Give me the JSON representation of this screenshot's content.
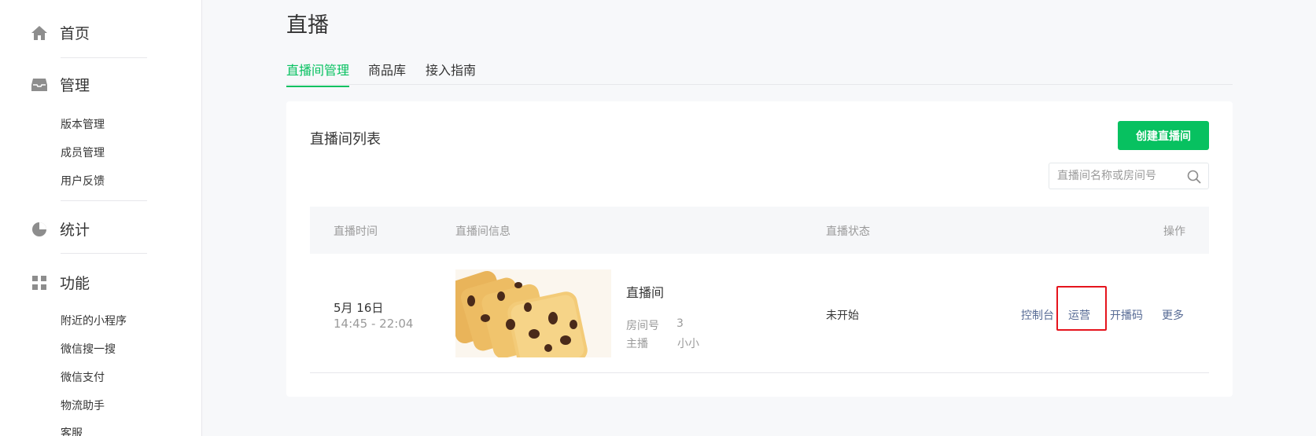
{
  "sidebar": {
    "home": {
      "label": "首页",
      "icon": "home-icon"
    },
    "manage": {
      "label": "管理",
      "icon": "inbox-icon",
      "items": [
        "版本管理",
        "成员管理",
        "用户反馈"
      ]
    },
    "stats": {
      "label": "统计",
      "icon": "pie-chart-icon"
    },
    "features": {
      "label": "功能",
      "icon": "grid-icon",
      "items": [
        "附近的小程序",
        "微信搜一搜",
        "微信支付",
        "物流助手",
        "客服"
      ]
    }
  },
  "page": {
    "title": "直播"
  },
  "tabs": [
    "直播间管理",
    "商品库",
    "接入指南"
  ],
  "active_tab": "直播间管理",
  "card": {
    "title": "直播间列表",
    "create_label": "创建直播间",
    "search_placeholder": "直播间名称或房间号"
  },
  "table": {
    "headers": {
      "time": "直播时间",
      "info": "直播间信息",
      "status": "直播状态",
      "ops": "操作"
    },
    "rows": [
      {
        "date": "5月 16日",
        "time": "14:45 - 22:04",
        "name": "直播间",
        "room_label": "房间号",
        "room_no": "3",
        "host_label": "主播",
        "host": "小小",
        "status": "未开始",
        "ops": [
          "控制台",
          "运营",
          "开播码",
          "更多"
        ]
      }
    ]
  },
  "colors": {
    "accent": "#07c160",
    "link": "#576b95",
    "highlight": "#e5141d"
  }
}
